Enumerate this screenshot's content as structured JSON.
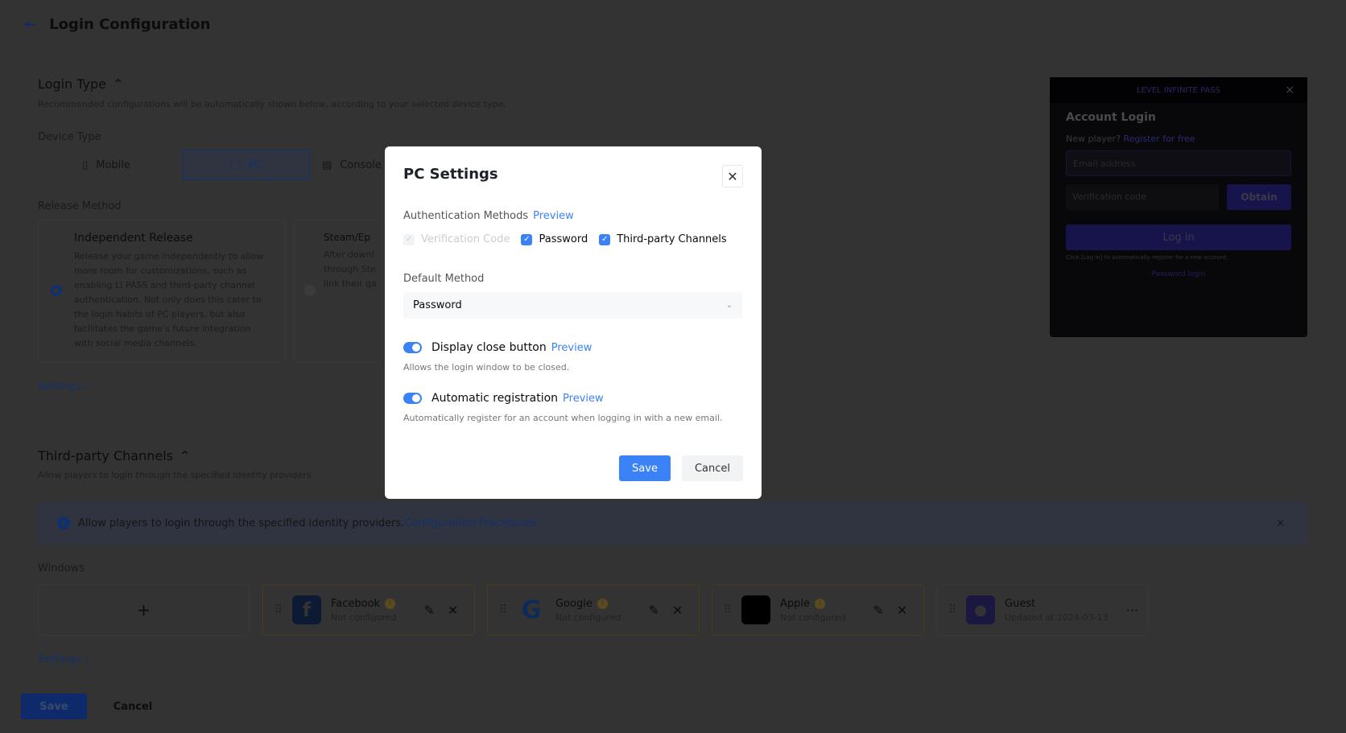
{
  "header": {
    "title": "Login Configuration",
    "back_icon": "arrow-left-icon"
  },
  "login_type": {
    "title": "Login Type",
    "description": "Recommended configurations will be automatically shown below, according to your selected device type.",
    "device_type_label": "Device Type",
    "devices": [
      {
        "label": "Mobile",
        "icon": "mobile-icon"
      },
      {
        "label": "PC",
        "icon": "monitor-icon",
        "selected": true
      },
      {
        "label": "Console",
        "icon": "console-icon"
      }
    ],
    "release_method_label": "Release Method",
    "release_methods": [
      {
        "title": "Independent Release",
        "description": "Release your game independently to allow more room for customizations, such as enabling LI PASS and third-party channel authentication. Not only does this cater to the login habits of PC players, but also facilitates the game's future integration with social media channels.",
        "selected": true
      },
      {
        "title": "Steam/Ep",
        "description": "After downl through Ste link their ga",
        "selected": false
      }
    ],
    "settings_link": "Settings"
  },
  "third_party": {
    "title": "Third-party Channels",
    "description": "Allow players to login through the specified identity providers.",
    "alert_text": "Allow players to login through the specified identity providers.",
    "alert_link": "Configuration Procedures",
    "platform_label": "Windows",
    "add_label": "+",
    "channels": [
      {
        "name": "Facebook",
        "status": "Not configured"
      },
      {
        "name": "Google",
        "status": "Not configured"
      },
      {
        "name": "Apple",
        "status": "Not configured"
      },
      {
        "name": "Guest",
        "status": "Updated at 2024-03-13"
      }
    ],
    "settings_link": "Settings"
  },
  "footer": {
    "save": "Save",
    "cancel": "Cancel"
  },
  "preview": {
    "brand": "LEVEL INFINITE PASS",
    "title": "Account Login",
    "new_player": "New player?",
    "register": "Register for free",
    "email_placeholder": "Email address",
    "code_placeholder": "Verification code",
    "obtain": "Obtain",
    "login": "Log in",
    "hint": "Click [Log in] to automatically register for a new account.",
    "password_login": "Password login"
  },
  "modal": {
    "title": "PC Settings",
    "auth_label": "Authentication Methods",
    "preview": "Preview",
    "methods": [
      {
        "label": "Verification Code",
        "checked": true,
        "disabled": true
      },
      {
        "label": "Password",
        "checked": true
      },
      {
        "label": "Third-party Channels",
        "checked": true
      }
    ],
    "default_label": "Default Method",
    "default_value": "Password",
    "close_button": {
      "label": "Display close button",
      "on": true,
      "description": "Allows the login window to be closed."
    },
    "auto_reg": {
      "label": "Automatic registration",
      "on": true,
      "description": "Automatically register for an account when logging in with a new email."
    },
    "save": "Save",
    "cancel": "Cancel"
  },
  "colors": {
    "primary": "#3b82f6",
    "brand_dark": "#1a56db",
    "warning": "#f0b429"
  }
}
